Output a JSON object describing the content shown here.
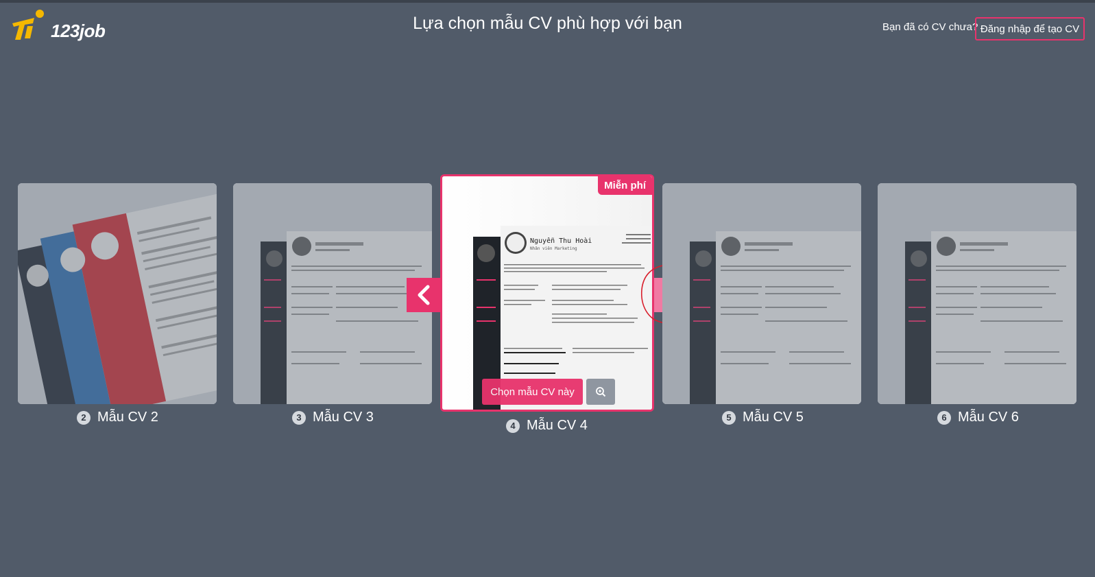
{
  "header": {
    "logo_text": "123job",
    "title": "Lựa chọn mẫu CV phù hợp với bạn",
    "question": "Bạn đã có CV chưa?",
    "login_label": "Đăng nhập để tạo CV"
  },
  "cards": [
    {
      "number": "2",
      "name": "Mẫu CV 2"
    },
    {
      "number": "3",
      "name": "Mẫu CV 3"
    },
    {
      "number": "4",
      "name": "Mẫu CV 4"
    },
    {
      "number": "5",
      "name": "Mẫu CV 5"
    },
    {
      "number": "6",
      "name": "Mẫu CV 6"
    }
  ],
  "active": {
    "badge": "Miễn phí",
    "choose_label": "Chọn mẫu CV này",
    "person_name": "Nguyễn Thu Hoài",
    "person_role": "Nhân viên Marketing"
  },
  "icons": {
    "prev": "chevron-left-icon",
    "next": "chevron-right-icon",
    "zoom": "zoom-in-icon"
  },
  "colors": {
    "accent": "#e8336c",
    "background": "#515b69"
  }
}
